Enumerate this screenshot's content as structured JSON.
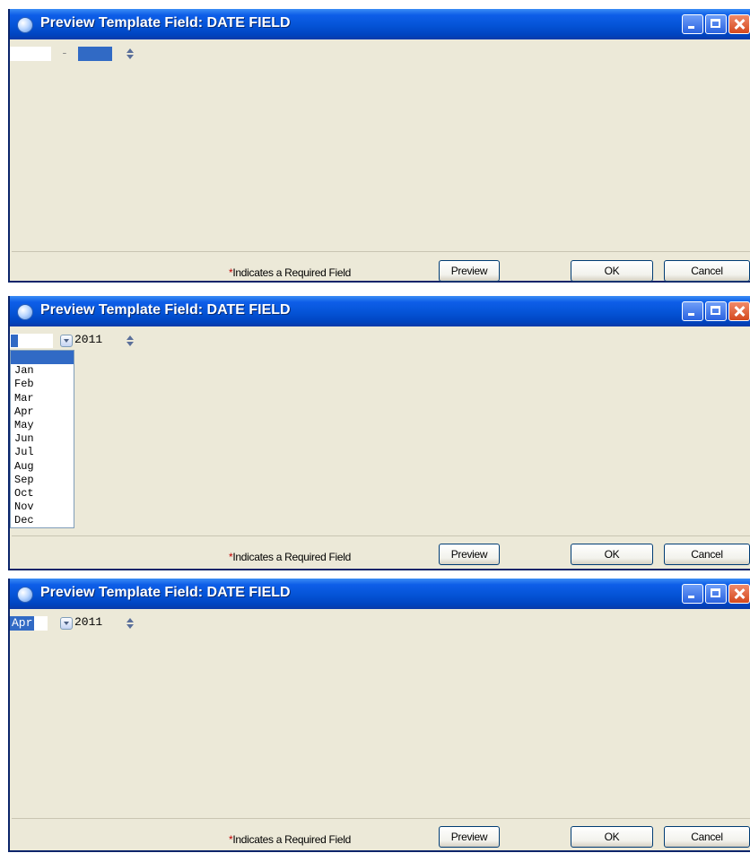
{
  "windows": [
    {
      "title": "Preview Template Field: DATE FIELD",
      "month_value": "",
      "separator": "-",
      "year_value": "",
      "required_label": "Indicates a Required Field",
      "asterisk": "*",
      "buttons": {
        "preview": "Preview",
        "ok": "OK",
        "cancel": "Cancel"
      }
    },
    {
      "title": "Preview Template Field: DATE FIELD",
      "month_value": "",
      "year_value": "2011",
      "month_options": [
        "",
        "Jan",
        "Feb",
        "Mar",
        "Apr",
        "May",
        "Jun",
        "Jul",
        "Aug",
        "Sep",
        "Oct",
        "Nov",
        "Dec"
      ],
      "required_label": "Indicates a Required Field",
      "asterisk": "*",
      "buttons": {
        "preview": "Preview",
        "ok": "OK",
        "cancel": "Cancel"
      }
    },
    {
      "title": "Preview Template Field: DATE FIELD",
      "month_value": "Apr",
      "year_value": "2011",
      "required_label": "Indicates a Required Field",
      "asterisk": "*",
      "buttons": {
        "preview": "Preview",
        "ok": "OK",
        "cancel": "Cancel"
      }
    }
  ],
  "colors": {
    "titlebar": "#0453d6",
    "dialog_bg": "#ece9d8",
    "selection": "#316ac5"
  },
  "icons": [
    "app-globe-icon",
    "minimize-icon",
    "maximize-icon",
    "close-icon",
    "dropdown-arrow-icon",
    "spinner-icon"
  ]
}
